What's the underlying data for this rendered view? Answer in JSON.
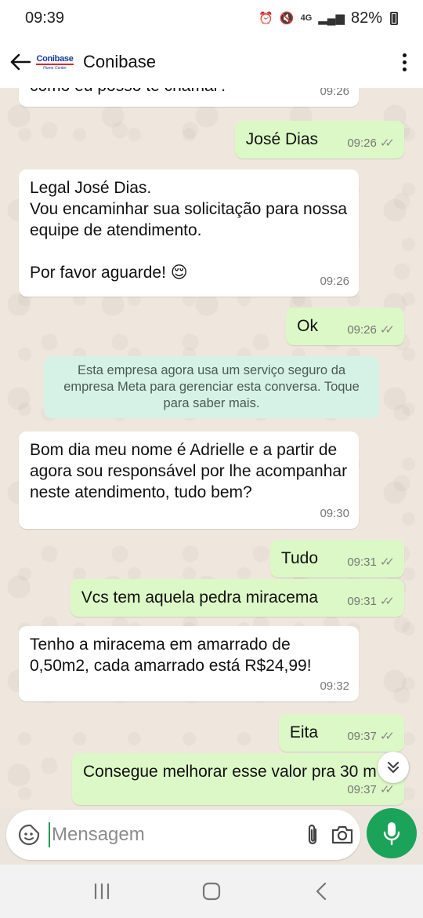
{
  "status_bar": {
    "time": "09:39",
    "network": "4G",
    "battery": "82%"
  },
  "header": {
    "contact_name": "Conibase",
    "logo_text": "Conibase",
    "logo_tagline": "Home Center"
  },
  "messages": [
    {
      "direction": "in",
      "text": "como eu posso te chamar?",
      "time": "09:26"
    },
    {
      "direction": "out",
      "text": "José Dias",
      "time": "09:26",
      "read": true
    },
    {
      "direction": "in",
      "text": "Legal José Dias.\nVou encaminhar sua solicitação para nossa equipe de atendimento.\n\nPor favor aguarde! 😌",
      "time": "09:26"
    },
    {
      "direction": "out",
      "text": "Ok",
      "time": "09:26",
      "read": true
    },
    {
      "direction": "in",
      "text": "Bom dia meu nome é Adrielle e a partir de agora sou responsável por lhe acompanhar neste atendimento, tudo bem?",
      "time": "09:30"
    },
    {
      "direction": "out",
      "text": "Tudo",
      "time": "09:31",
      "read": true
    },
    {
      "direction": "out",
      "text": "Vcs tem aquela pedra miracema",
      "time": "09:31",
      "read": true
    },
    {
      "direction": "in",
      "text": "Tenho a miracema em amarrado de 0,50m2, cada amarrado está R$24,99!",
      "time": "09:32"
    },
    {
      "direction": "out",
      "text": "Eita",
      "time": "09:37",
      "read": true
    },
    {
      "direction": "out",
      "text": "Consegue melhorar esse valor pra 30 m",
      "time": "09:37",
      "read": true
    }
  ],
  "system_notice": "Esta empresa agora usa um serviço seguro da empresa Meta para gerenciar esta conversa. Toque para saber mais.",
  "composer": {
    "placeholder": "Mensagem"
  },
  "icons": {
    "back": "back-arrow-icon",
    "menu": "more-vert-icon",
    "sticker": "sticker-icon",
    "attach": "paperclip-icon",
    "camera": "camera-icon",
    "mic": "microphone-icon",
    "scroll_down": "chevron-double-down-icon",
    "read_receipt": "double-check-icon"
  },
  "colors": {
    "outgoing_bubble": "#dcf8c6",
    "incoming_bubble": "#ffffff",
    "accent_green": "#1ba35a",
    "system_notice_bg": "#d6f2e6"
  }
}
